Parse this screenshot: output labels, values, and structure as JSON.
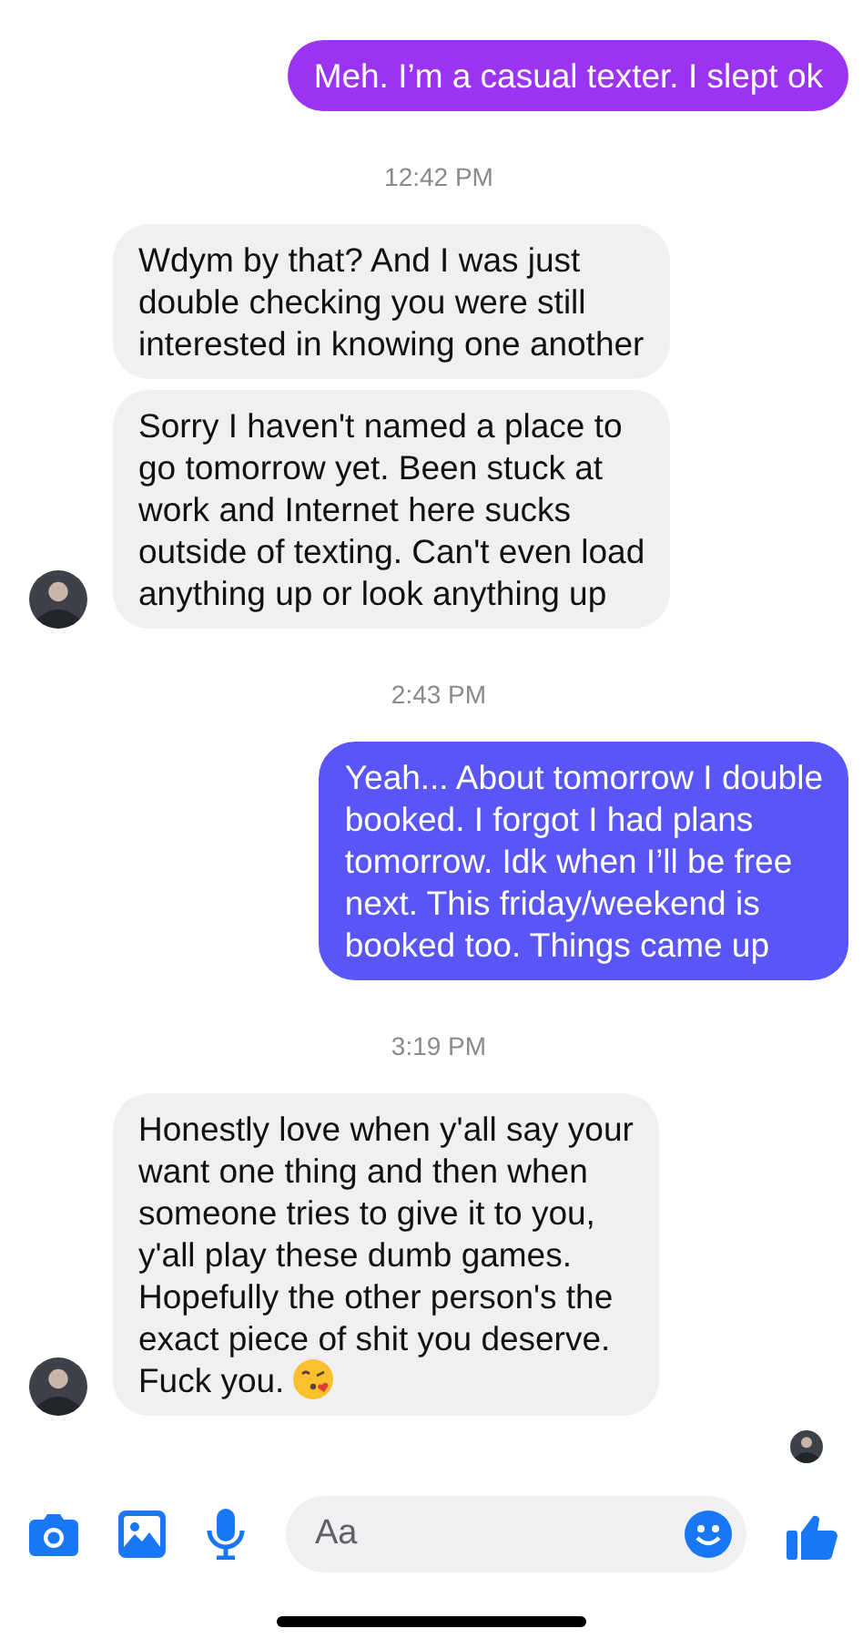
{
  "messages": [
    {
      "kind": "sent",
      "text": "Meh. I’m a casual texter. I slept ok",
      "color": "#9b34f0"
    },
    {
      "kind": "time",
      "text": "12:42 PM"
    },
    {
      "kind": "received",
      "text": "Wdym by that? And I was just\ndouble checking you were still\ninterested in knowing one another",
      "avatar": false
    },
    {
      "kind": "received",
      "text": "Sorry I haven't named a place to\ngo tomorrow yet. Been stuck at\nwork and Internet here sucks\noutside of texting. Can't even load\nanything up or look anything up",
      "avatar": true
    },
    {
      "kind": "time",
      "text": "2:43 PM"
    },
    {
      "kind": "sent",
      "text": "Yeah... About tomorrow I double\nbooked. I forgot I had plans\ntomorrow. Idk when I’ll be free\nnext. This friday/weekend is\nbooked too. Things came up",
      "color": "#5a55f7"
    },
    {
      "kind": "time",
      "text": "3:19 PM"
    },
    {
      "kind": "received",
      "text": "Honestly love when y'all say your\nwant one thing and then when\nsomeone tries to give it to you,\ny'all play these dumb games.\nHopefully the other person's the\nexact piece of shit you deserve.\nFuck you.",
      "avatar": true,
      "emoji": true
    }
  ],
  "read_receipt": true,
  "composer": {
    "placeholder": "Aa"
  }
}
